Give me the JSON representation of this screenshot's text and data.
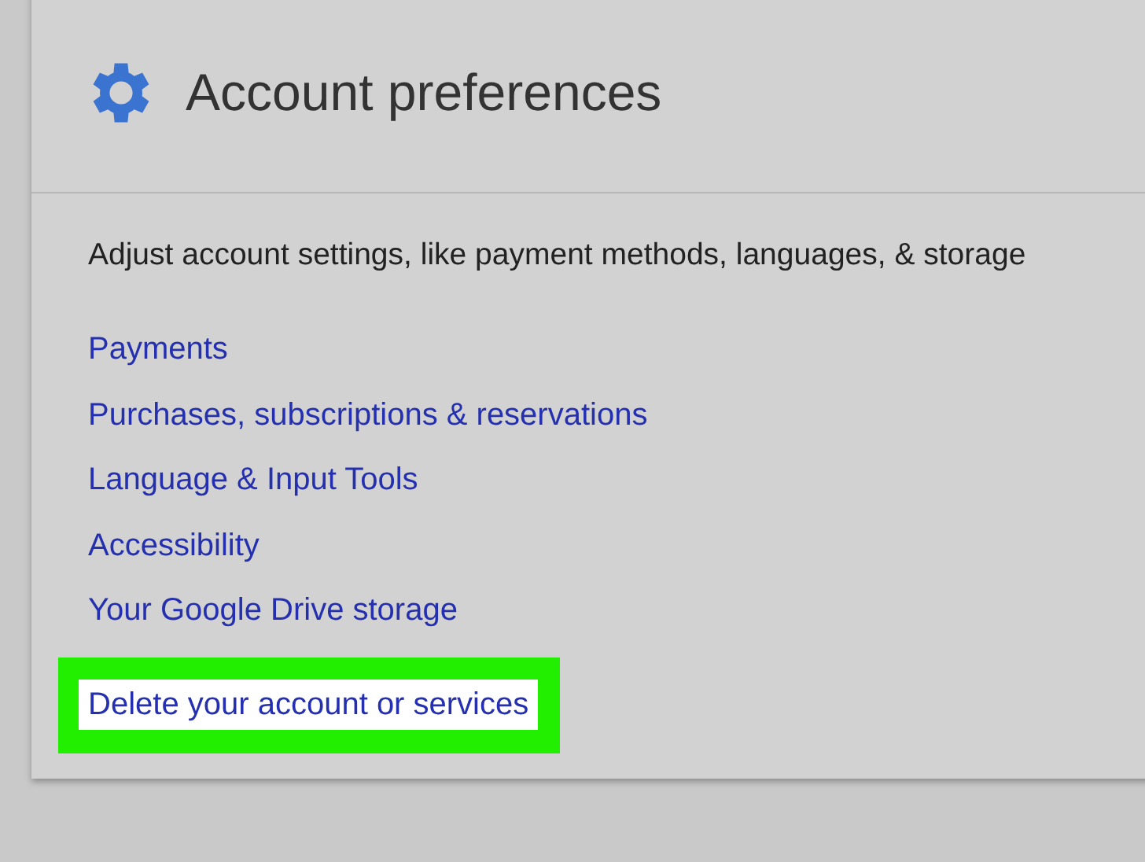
{
  "header": {
    "title": "Account preferences"
  },
  "description": "Adjust account settings, like payment methods, languages, & storage",
  "links": [
    {
      "label": "Payments",
      "highlighted": false
    },
    {
      "label": "Purchases, subscriptions & reservations",
      "highlighted": false
    },
    {
      "label": "Language & Input Tools",
      "highlighted": false
    },
    {
      "label": "Accessibility",
      "highlighted": false
    },
    {
      "label": "Your Google Drive storage",
      "highlighted": false
    },
    {
      "label": "Delete your account or services",
      "highlighted": true
    }
  ]
}
